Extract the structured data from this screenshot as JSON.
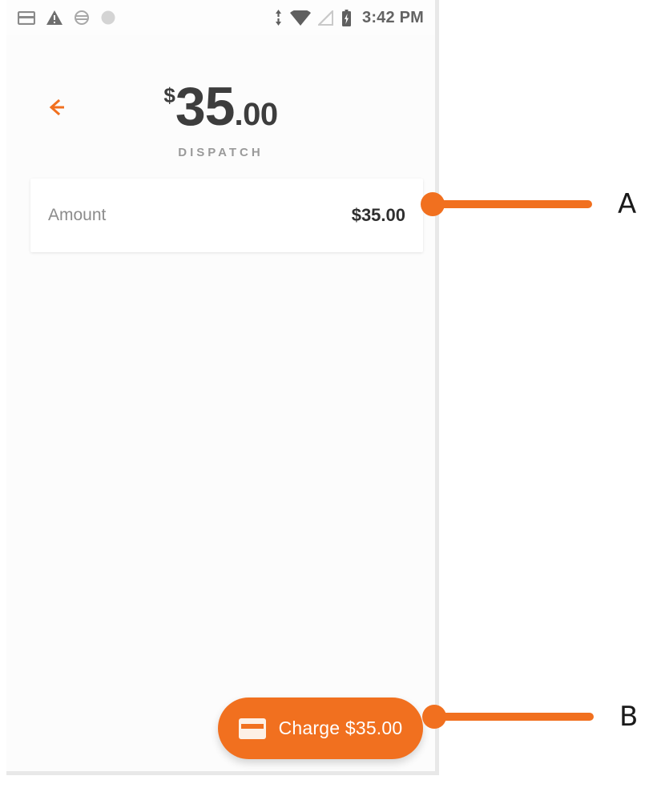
{
  "phone": {
    "status_bar": {
      "time": "3:42 PM",
      "left_icons": [
        {
          "name": "card-status-icon",
          "label": "card"
        },
        {
          "name": "warning-triangle-icon",
          "label": "warning"
        },
        {
          "name": "sync-circle-icon",
          "label": "sync"
        },
        {
          "name": "circle-icon",
          "label": "circle"
        }
      ],
      "right_icons": [
        {
          "name": "data-transfer-icon",
          "label": "data transfer"
        },
        {
          "name": "wifi-icon",
          "label": "wifi"
        },
        {
          "name": "no-signal-icon",
          "label": "no signal"
        },
        {
          "name": "battery-charging-icon",
          "label": "battery charging"
        }
      ]
    },
    "header": {
      "back_label": "Back",
      "currency_symbol": "$",
      "amount_whole": "35",
      "amount_cents": ".00",
      "subtitle": "DISPATCH"
    },
    "amount_card": {
      "label": "Amount",
      "value": "$35.00"
    },
    "charge_button": {
      "label": "Charge $35.00",
      "icon": "credit-card-icon"
    }
  },
  "annotations": [
    {
      "id": "A",
      "label": "A",
      "target": "amount-card"
    },
    {
      "id": "B",
      "label": "B",
      "target": "charge-button"
    }
  ],
  "colors": {
    "accent": "#f1701f",
    "screen_bg": "#fcfcfc",
    "card_bg": "#ffffff",
    "text_dark": "#3d3d3d",
    "text_muted": "#9a9a9a"
  }
}
